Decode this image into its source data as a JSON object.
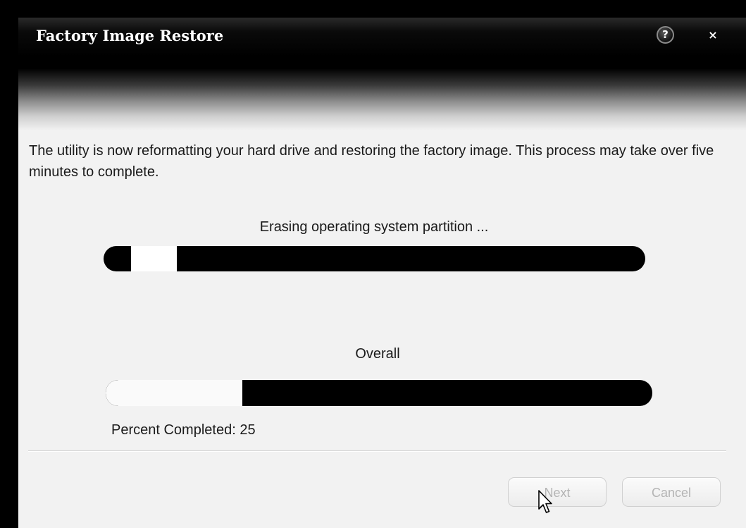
{
  "window": {
    "title": "Factory Image Restore"
  },
  "titlebar": {
    "help_label": "?",
    "close_label": "×"
  },
  "message": "The utility is now reformatting your hard drive and restoring the factory image. This process may take over five minutes to complete.",
  "current_task": {
    "label": "Erasing operating system partition ...",
    "style": "marquee"
  },
  "overall": {
    "label": "Overall",
    "percent_label": "Percent Completed:",
    "percent_value": "25",
    "progress_fraction": 0.25
  },
  "buttons": {
    "next_label": "Next",
    "next_enabled": false,
    "cancel_label": "Cancel",
    "cancel_enabled": false
  },
  "colors": {
    "titlebar": "#000000",
    "progress_track": "#000000",
    "progress_fill": "#fafafa",
    "window_bg": "#f2f2f2"
  }
}
